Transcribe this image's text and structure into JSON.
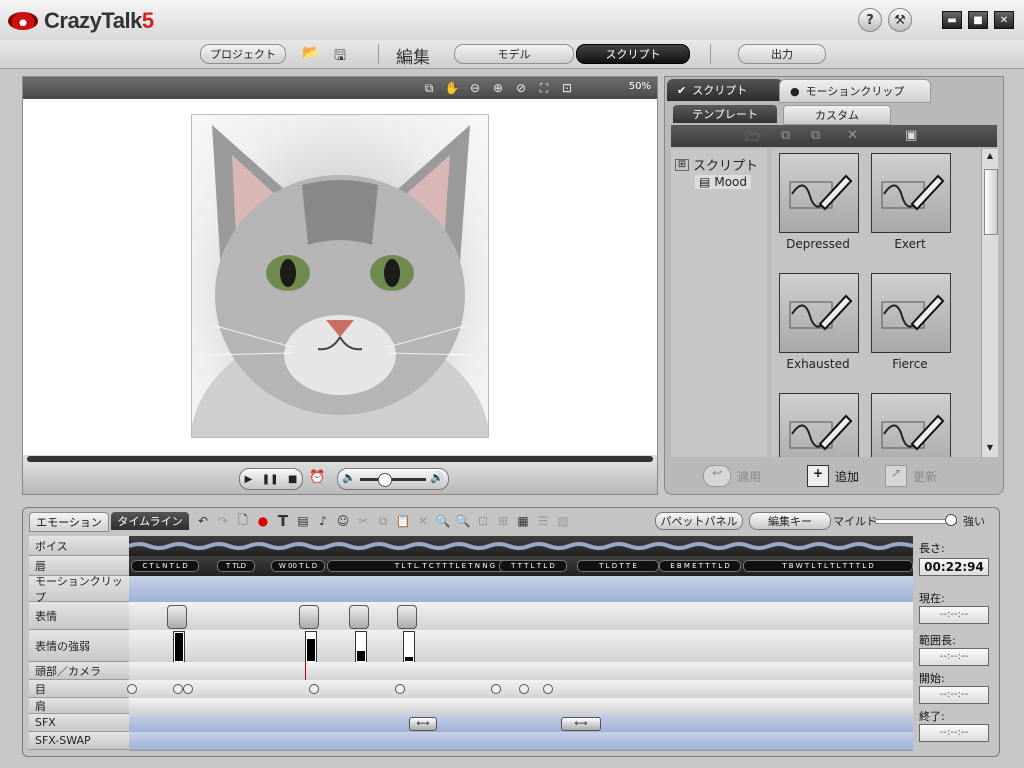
{
  "app": {
    "title_main": "CrazyTalk",
    "title_version": "5"
  },
  "titlebar": {
    "help_icon": "question-icon",
    "help_glyph": "?",
    "settings_glyph": "⚒",
    "min_glyph": "▬",
    "max_glyph": "■",
    "close_glyph": "✕"
  },
  "nav": {
    "project": "プロジェクト",
    "open_glyph": "📂",
    "save_glyph": "🖫",
    "edit_label": "編集",
    "model": "モデル",
    "script": "スクリプト",
    "output": "出力"
  },
  "viewer": {
    "zoom": "50%",
    "icons": [
      "⧉",
      "✋",
      "⊖",
      "⊕",
      "⊘",
      "⛶",
      "⊡"
    ],
    "transport": {
      "play": "▶",
      "pause": "❚❚",
      "stop": "■"
    },
    "vol_low": "🔈",
    "vol_high": "🔊",
    "record_icon": "⏰"
  },
  "panel": {
    "tab_script": "スクリプト",
    "tab_motion": "モーションクリップ",
    "sub_template": "テンプレート",
    "sub_custom": "カスタム",
    "tree_root": "スクリプト",
    "tree_child": "Mood",
    "thumbs": [
      "Depressed",
      "Exert",
      "Exhausted",
      "Fierce",
      "",
      ""
    ],
    "apply": "適用",
    "add": "追加",
    "update": "更新"
  },
  "emotion": {
    "tab_emotion": "エモーション",
    "tab_timeline": "タイムライン",
    "puppet_panel": "パペットパネル",
    "edit_key": "編集キー",
    "mild": "マイルド",
    "strong": "強い",
    "tracks": [
      "ボイス",
      "唇",
      "モーションクリップ",
      "表情",
      "表情の強弱",
      "頭部／カメラ",
      "目",
      "肩",
      "SFX",
      "SFX-SWAP"
    ],
    "lip_chips": [
      "C T L N T L D",
      "T TLD",
      "W 00 T L D",
      "T L T L. T C T T T L E T N N G",
      "T T T L T L D",
      "T L D T T E",
      "E B M E T T T L D",
      "T B W T L T L T L T T T L D"
    ],
    "side": {
      "length_label": "長さ:",
      "length_value": "00:22:94",
      "current_label": "現在:",
      "current_value": "--:--:--",
      "range_label": "範囲長:",
      "range_value": "--:--:--",
      "start_label": "開始:",
      "start_value": "--:--:--",
      "end_label": "終了:",
      "end_value": "--:--:--"
    }
  },
  "colors": {
    "accent": "#c22222",
    "track_blue": "#9eb1d6",
    "dark": "#2b2b2b"
  }
}
